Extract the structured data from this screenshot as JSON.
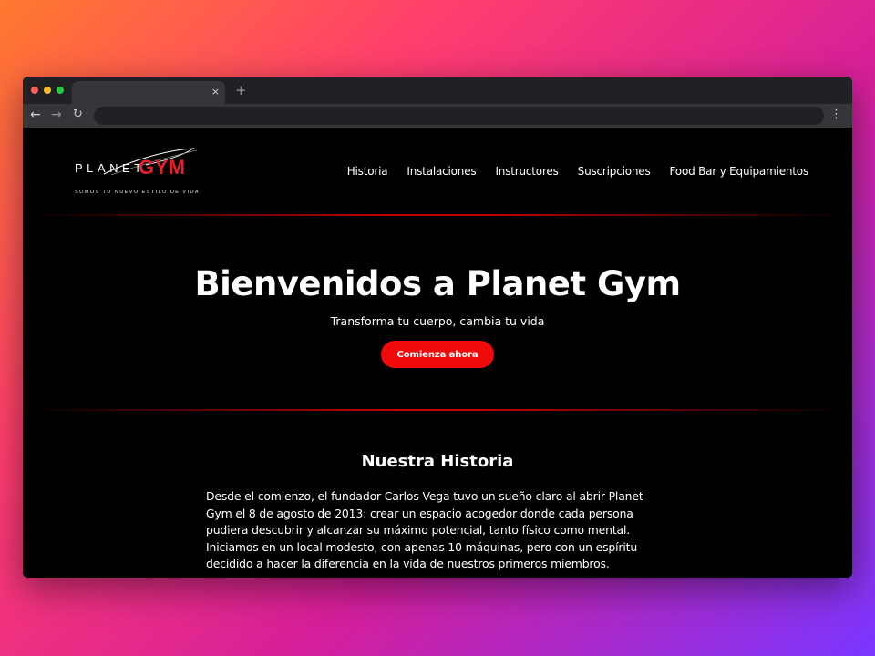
{
  "browser": {
    "tab_close": "×",
    "new_tab": "+",
    "back": "←",
    "forward": "→",
    "reload": "↻",
    "menu": "⋮"
  },
  "site": {
    "logo": {
      "planet": "PLANET",
      "gym": "GYM",
      "tagline": "SOMOS TU NUEVO ESTILO DE VIDA"
    },
    "nav": [
      {
        "label": "Historia"
      },
      {
        "label": "Instalaciones"
      },
      {
        "label": "Instructores"
      },
      {
        "label": "Suscripciones"
      },
      {
        "label": "Food Bar y Equipamientos"
      }
    ],
    "hero": {
      "title": "Bienvenidos a Planet Gym",
      "subtitle": "Transforma tu cuerpo, cambia tu vida",
      "cta": "Comienza ahora"
    },
    "history": {
      "title": "Nuestra Historia",
      "body": "Desde el comienzo, el fundador Carlos Vega tuvo un sueño claro al abrir Planet Gym el 8 de agosto de 2013: crear un espacio acogedor donde cada persona pudiera descubrir y alcanzar su máximo potencial, tanto físico como mental. Iniciamos en un local modesto, con apenas 10 máquinas, pero con un espíritu decidido a hacer la diferencia en la vida de nuestros primeros miembros."
    }
  },
  "colors": {
    "brand_red": "#e4202b",
    "cta_red": "#f00a0a",
    "separator": "#c40000",
    "page_bg": "#000000"
  }
}
